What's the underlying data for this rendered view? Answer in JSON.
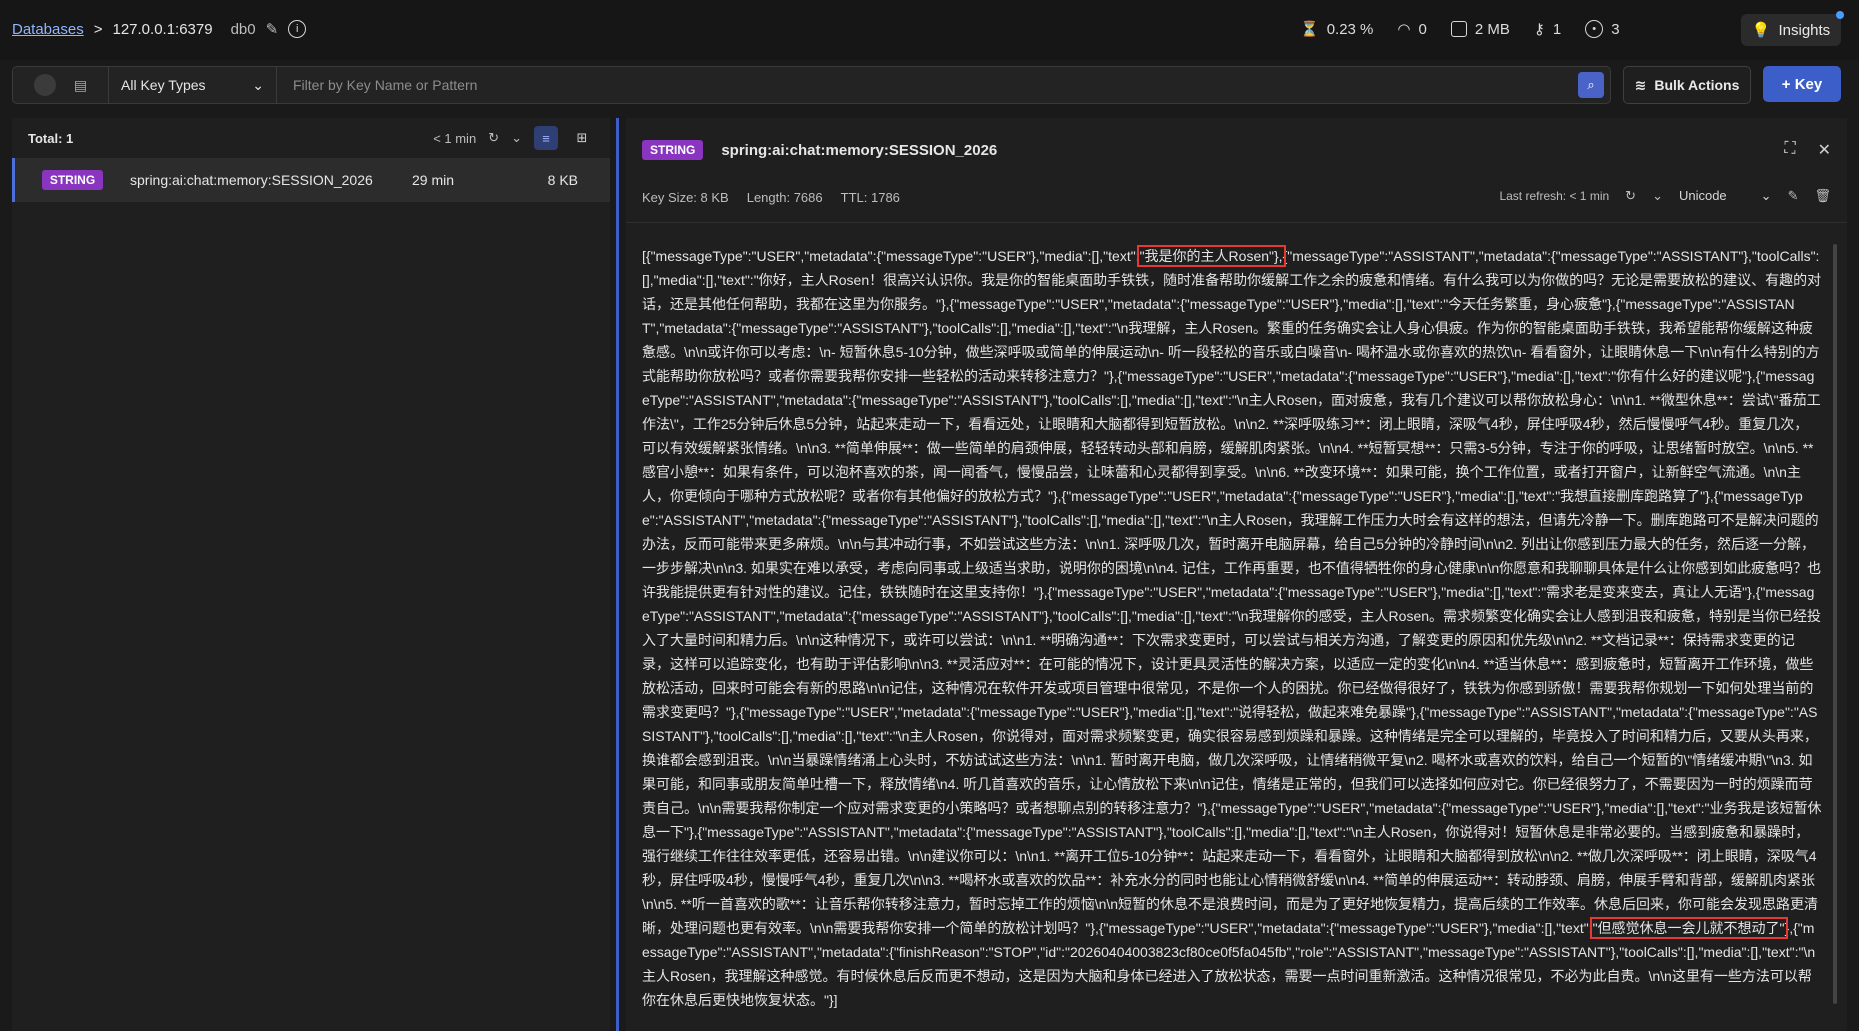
{
  "breadcrumb": {
    "databases": "Databases",
    "separator": ">",
    "host": "127.0.0.1:6379",
    "db": "db0"
  },
  "stats": [
    {
      "icon": "cpu-icon",
      "value": "0.23 %"
    },
    {
      "icon": "speed-icon",
      "value": "0"
    },
    {
      "icon": "memory-icon",
      "value": "2 MB"
    },
    {
      "icon": "key-icon",
      "value": "1"
    },
    {
      "icon": "users-icon",
      "value": "3"
    }
  ],
  "insights_label": "Insights",
  "filter": {
    "key_types": "All Key Types",
    "placeholder": "Filter by Key Name or Pattern"
  },
  "bulk_actions": "Bulk Actions",
  "add_key": "+ Key",
  "key_list": {
    "total": "Total: 1",
    "refresh": "< 1 min",
    "rows": [
      {
        "type": "STRING",
        "name": "spring:ai:chat:memory:SESSION_2026",
        "ttl": "29 min",
        "size": "8 KB"
      }
    ]
  },
  "detail": {
    "type": "STRING",
    "key": "spring:ai:chat:memory:SESSION_2026",
    "key_size": "Key Size: 8 KB",
    "length": "Length: 7686",
    "ttl": "TTL:",
    "ttl_value": "1786",
    "last_refresh": "Last refresh: < 1 min",
    "encoding": "Unicode",
    "value_part1": "[{\"messageType\":\"USER\",\"metadata\":{\"messageType\":\"USER\"},\"media\":[],\"text\":",
    "value_hl1": "\"我是你的主人Rosen\"},",
    "value_part2": "{\"messageType\":\"ASSISTANT\",\"metadata\":{\"messageType\":\"ASSISTANT\"},\"toolCalls\":[],\"media\":[],\"text\":\"你好，主人Rosen！很高兴认识你。我是你的智能桌面助手铁铁，随时准备帮助你缓解工作之余的疲惫和情绪。有什么我可以为你做的吗？无论是需要放松的建议、有趣的对话，还是其他任何帮助，我都在这里为你服务。\"},{\"messageType\":\"USER\",\"metadata\":{\"messageType\":\"USER\"},\"media\":[],\"text\":\"今天任务繁重，身心疲惫\"},{\"messageType\":\"ASSISTANT\",\"metadata\":{\"messageType\":\"ASSISTANT\"},\"toolCalls\":[],\"media\":[],\"text\":\"\\n我理解，主人Rosen。繁重的任务确实会让人身心俱疲。作为你的智能桌面助手铁铁，我希望能帮你缓解这种疲惫感。\\n\\n或许你可以考虑：\\n- 短暂休息5-10分钟，做些深呼吸或简单的伸展运动\\n- 听一段轻松的音乐或白噪音\\n- 喝杯温水或你喜欢的热饮\\n- 看看窗外，让眼睛休息一下\\n\\n有什么特别的方式能帮助你放松吗？或者你需要我帮你安排一些轻松的活动来转移注意力？\"},{\"messageType\":\"USER\",\"metadata\":{\"messageType\":\"USER\"},\"media\":[],\"text\":\"你有什么好的建议呢\"},{\"messageType\":\"ASSISTANT\",\"metadata\":{\"messageType\":\"ASSISTANT\"},\"toolCalls\":[],\"media\":[],\"text\":\"\\n主人Rosen，面对疲惫，我有几个建议可以帮你放松身心：\\n\\n1. **微型休息**：尝试\\\"番茄工作法\\\"，工作25分钟后休息5分钟，站起来走动一下，看看远处，让眼睛和大脑都得到短暂放松。\\n\\n2. **深呼吸练习**：闭上眼睛，深吸气4秒，屏住呼吸4秒，然后慢慢呼气4秒。重复几次，可以有效缓解紧张情绪。\\n\\n3. **简单伸展**：做一些简单的肩颈伸展，轻轻转动头部和肩膀，缓解肌肉紧张。\\n\\n4. **短暂冥想**：只需3-5分钟，专注于你的呼吸，让思绪暂时放空。\\n\\n5. **感官小憩**：如果有条件，可以泡杯喜欢的茶，闻一闻香气，慢慢品尝，让味蕾和心灵都得到享受。\\n\\n6. **改变环境**：如果可能，换个工作位置，或者打开窗户，让新鲜空气流通。\\n\\n主人，你更倾向于哪种方式放松呢？或者你有其他偏好的放松方式？\"},{\"messageType\":\"USER\",\"metadata\":{\"messageType\":\"USER\"},\"media\":[],\"text\":\"我想直接删库跑路算了\"},{\"messageType\":\"ASSISTANT\",\"metadata\":{\"messageType\":\"ASSISTANT\"},\"toolCalls\":[],\"media\":[],\"text\":\"\\n主人Rosen，我理解工作压力大时会有这样的想法，但请先冷静一下。删库跑路可不是解决问题的办法，反而可能带来更多麻烦。\\n\\n与其冲动行事，不如尝试这些方法：\\n\\n1. 深呼吸几次，暂时离开电脑屏幕，给自己5分钟的冷静时间\\n\\n2. 列出让你感到压力最大的任务，然后逐一分解，一步步解决\\n\\n3. 如果实在难以承受，考虑向同事或上级适当求助，说明你的困境\\n\\n4. 记住，工作再重要，也不值得牺牲你的身心健康\\n\\n你愿意和我聊聊具体是什么让你感到如此疲惫吗？也许我能提供更有针对性的建议。记住，铁铁随时在这里支持你！\"},{\"messageType\":\"USER\",\"metadata\":{\"messageType\":\"USER\"},\"media\":[],\"text\":\"需求老是变来变去，真让人无语\"},{\"messageType\":\"ASSISTANT\",\"metadata\":{\"messageType\":\"ASSISTANT\"},\"toolCalls\":[],\"media\":[],\"text\":\"\\n我理解你的感受，主人Rosen。需求频繁变化确实会让人感到沮丧和疲惫，特别是当你已经投入了大量时间和精力后。\\n\\n这种情况下，或许可以尝试：\\n\\n1. **明确沟通**：下次需求变更时，可以尝试与相关方沟通，了解变更的原因和优先级\\n\\n2. **文档记录**：保持需求变更的记录，这样可以追踪变化，也有助于评估影响\\n\\n3. **灵活应对**：在可能的情况下，设计更具灵活性的解决方案，以适应一定的变化\\n\\n4. **适当休息**：感到疲惫时，短暂离开工作环境，做些放松活动，回来时可能会有新的思路\\n\\n记住，这种情况在软件开发或项目管理中很常见，不是你一个人的困扰。你已经做得很好了，铁铁为你感到骄傲！需要我帮你规划一下如何处理当前的需求变更吗？\"},{\"messageType\":\"USER\",\"metadata\":{\"messageType\":\"USER\"},\"media\":[],\"text\":\"说得轻松，做起来难免暴躁\"},{\"messageType\":\"ASSISTANT\",\"metadata\":{\"messageType\":\"ASSISTANT\"},\"toolCalls\":[],\"media\":[],\"text\":\"\\n主人Rosen，你说得对，面对需求频繁变更，确实很容易感到烦躁和暴躁。这种情绪是完全可以理解的，毕竟投入了时间和精力后，又要从头再来，换谁都会感到沮丧。\\n\\n当暴躁情绪涌上心头时，不妨试试这些方法：\\n\\n1. 暂时离开电脑，做几次深呼吸，让情绪稍微平复\\n2. 喝杯水或喜欢的饮料，给自己一个短暂的\\\"情绪缓冲期\\\"\\n3. 如果可能，和同事或朋友简单吐槽一下，释放情绪\\n4. 听几首喜欢的音乐，让心情放松下来\\n\\n记住，情绪是正常的，但我们可以选择如何应对它。你已经很努力了，不需要因为一时的烦躁而苛责自己。\\n\\n需要我帮你制定一个应对需求变更的小策略吗？或者想聊点别的转移注意力？\"},{\"messageType\":\"USER\",\"metadata\":{\"messageType\":\"USER\"},\"media\":[],\"text\":\"业务我是该短暂休息一下\"},{\"messageType\":\"ASSISTANT\",\"metadata\":{\"messageType\":\"ASSISTANT\"},\"toolCalls\":[],\"media\":[],\"text\":\"\\n主人Rosen，你说得对！短暂休息是非常必要的。当感到疲惫和暴躁时，强行继续工作往往效率更低，还容易出错。\\n\\n建议你可以：\\n\\n1. **离开工位5-10分钟**：站起来走动一下，看看窗外，让眼睛和大脑都得到放松\\n\\n2. **做几次深呼吸**：闭上眼睛，深吸气4秒，屏住呼吸4秒，慢慢呼气4秒，重复几次\\n\\n3. **喝杯水或喜欢的饮品**：补充水分的同时也能让心情稍微舒缓\\n\\n4. **简单的伸展运动**：转动脖颈、肩膀，伸展手臂和背部，缓解肌肉紧张\\n\\n5. **听一首喜欢的歌**：让音乐帮你转移注意力，暂时忘掉工作的烦恼\\n\\n短暂的休息不是浪费时间，而是为了更好地恢复精力，提高后续的工作效率。休息后回来，你可能会发现思路更清晰，处理问题也更有效率。\\n\\n需要我帮你安排一个简单的放松计划吗？\"},{\"messageType\":\"USER\",\"metadata\":{\"messageType\":\"USER\"},\"media\":[],\"text\":",
    "value_hl2": "\"但感觉休息一会儿就不想动了\"",
    "value_part3": "},{\"messageType\":\"ASSISTANT\",\"metadata\":{\"finishReason\":\"STOP\",\"id\":\"20260404003823cf80ce0f5fa045fb\",\"role\":\"ASSISTANT\",\"messageType\":\"ASSISTANT\"},\"toolCalls\":[],\"media\":[],\"text\":\"\\n主人Rosen，我理解这种感觉。有时候休息后反而更不想动，这是因为大脑和身体已经进入了放松状态，需要一点时间重新激活。这种情况很常见，不必为此自责。\\n\\n这里有一些方法可以帮你在休息后更快地恢复状态。\"}]"
  }
}
